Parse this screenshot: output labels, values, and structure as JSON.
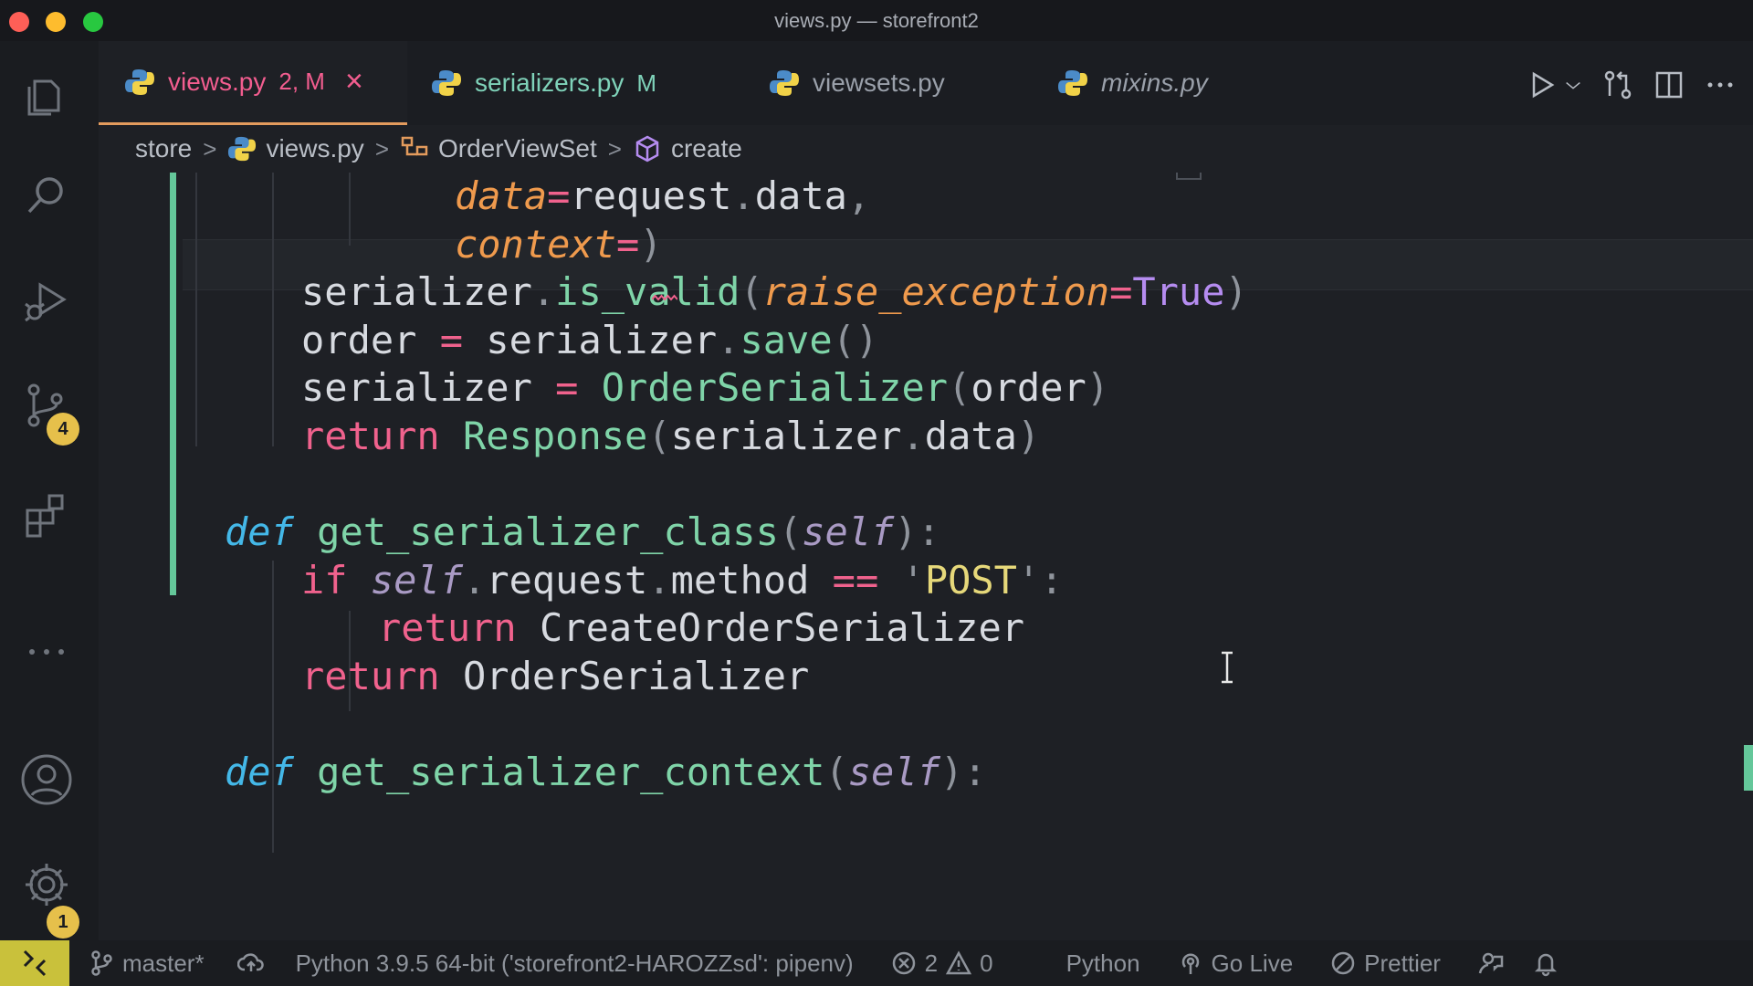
{
  "window": {
    "title": "views.py — storefront2"
  },
  "activity_bar": {
    "source_control_badge": "4",
    "settings_badge": "1"
  },
  "tabs": [
    {
      "name": "views.py",
      "status": "2, M",
      "active": true
    },
    {
      "name": "serializers.py",
      "status": "M"
    },
    {
      "name": "viewsets.py",
      "status": ""
    },
    {
      "name": "mixins.py",
      "status": ""
    }
  ],
  "breadcrumb": {
    "items": [
      "store",
      "views.py",
      "OrderViewSet",
      "create"
    ]
  },
  "code": {
    "lines": [
      {
        "indent": 4,
        "tokens": [
          [
            "param",
            "data"
          ],
          [
            "op",
            "="
          ],
          [
            "plain",
            "request"
          ],
          [
            "punc",
            "."
          ],
          [
            "plain",
            "data"
          ],
          [
            "punc",
            ","
          ]
        ]
      },
      {
        "indent": 4,
        "tokens": [
          [
            "param",
            "context"
          ],
          [
            "op",
            "="
          ],
          [
            "punc",
            ")"
          ]
        ]
      },
      {
        "indent": 2,
        "tokens": [
          [
            "plain",
            "serializer"
          ],
          [
            "punc",
            "."
          ],
          [
            "fn",
            "is_valid"
          ],
          [
            "punc",
            "("
          ],
          [
            "param",
            "raise_exception"
          ],
          [
            "op",
            "="
          ],
          [
            "bool",
            "True"
          ],
          [
            "punc",
            ")"
          ]
        ]
      },
      {
        "indent": 2,
        "tokens": [
          [
            "plain",
            "order "
          ],
          [
            "op",
            "="
          ],
          [
            "plain",
            " serializer"
          ],
          [
            "punc",
            "."
          ],
          [
            "fn",
            "save"
          ],
          [
            "punc",
            "()"
          ]
        ]
      },
      {
        "indent": 2,
        "tokens": [
          [
            "plain",
            "serializer "
          ],
          [
            "op",
            "="
          ],
          [
            "plain",
            " "
          ],
          [
            "cls",
            "OrderSerializer"
          ],
          [
            "punc",
            "("
          ],
          [
            "plain",
            "order"
          ],
          [
            "punc",
            ")"
          ]
        ]
      },
      {
        "indent": 2,
        "tokens": [
          [
            "kw",
            "return"
          ],
          [
            "plain",
            " "
          ],
          [
            "cls",
            "Response"
          ],
          [
            "punc",
            "("
          ],
          [
            "plain",
            "serializer"
          ],
          [
            "punc",
            "."
          ],
          [
            "plain",
            "data"
          ],
          [
            "punc",
            ")"
          ]
        ]
      },
      {
        "indent": 0,
        "tokens": []
      },
      {
        "indent": 1,
        "tokens": [
          [
            "def",
            "def"
          ],
          [
            "plain",
            " "
          ],
          [
            "fn",
            "get_serializer_class"
          ],
          [
            "punc",
            "("
          ],
          [
            "self",
            "self"
          ],
          [
            "punc",
            "):"
          ]
        ]
      },
      {
        "indent": 2,
        "tokens": [
          [
            "kw",
            "if"
          ],
          [
            "plain",
            " "
          ],
          [
            "self",
            "self"
          ],
          [
            "punc",
            "."
          ],
          [
            "plain",
            "request"
          ],
          [
            "punc",
            "."
          ],
          [
            "plain",
            "method "
          ],
          [
            "op",
            "=="
          ],
          [
            "plain",
            " "
          ],
          [
            "punc",
            "'"
          ],
          [
            "str",
            "POST"
          ],
          [
            "punc",
            "':"
          ]
        ]
      },
      {
        "indent": 3,
        "tokens": [
          [
            "kw",
            "return"
          ],
          [
            "plain",
            " CreateOrderSerializer"
          ]
        ]
      },
      {
        "indent": 2,
        "tokens": [
          [
            "kw",
            "return"
          ],
          [
            "plain",
            " OrderSerializer"
          ]
        ]
      },
      {
        "indent": 0,
        "tokens": []
      },
      {
        "indent": 1,
        "tokens": [
          [
            "def",
            "def"
          ],
          [
            "plain",
            " "
          ],
          [
            "fn",
            "get_serializer_context"
          ],
          [
            "punc",
            "("
          ],
          [
            "self",
            "self"
          ],
          [
            "punc",
            "):"
          ]
        ]
      }
    ]
  },
  "status_bar": {
    "branch": "master*",
    "interpreter": "Python 3.9.5 64-bit ('storefront2-HAROZZsd': pipenv)",
    "errors": "2",
    "warnings": "0",
    "language": "Python",
    "go_live": "Go Live",
    "prettier": "Prettier"
  },
  "colors": {
    "accent_tab": "#f25d8f",
    "git_added": "#64c79a",
    "remote_button": "#c9c13b",
    "badge": "#e6c04b"
  }
}
